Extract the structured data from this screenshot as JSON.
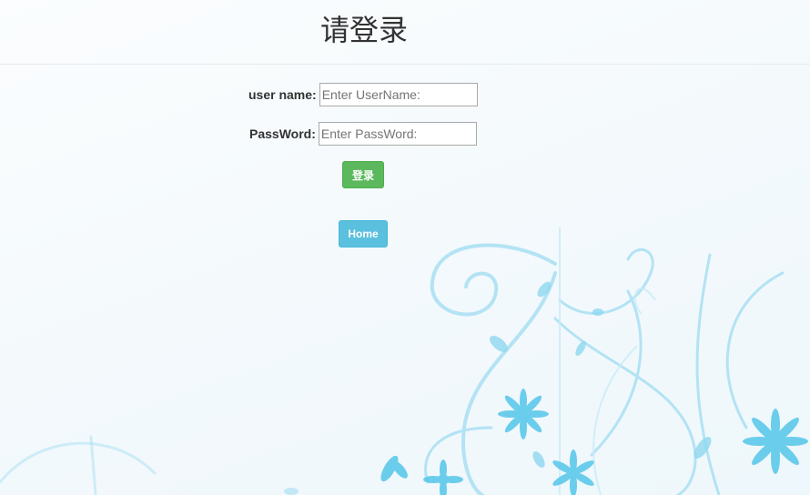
{
  "header": {
    "title": "请登录"
  },
  "login_form": {
    "username_label": "user name:",
    "username_placeholder": "Enter UserName:",
    "username_value": "",
    "password_label": "PassWord:",
    "password_placeholder": "Enter PassWord:",
    "password_value": "",
    "login_button_label": "登录",
    "home_button_label": "Home"
  },
  "colors": {
    "login_button": "#5cb85c",
    "home_button": "#5bc0de",
    "decoration_blue": "#7fd0ec"
  },
  "icons": {
    "background": "floral-swirl-decoration"
  }
}
